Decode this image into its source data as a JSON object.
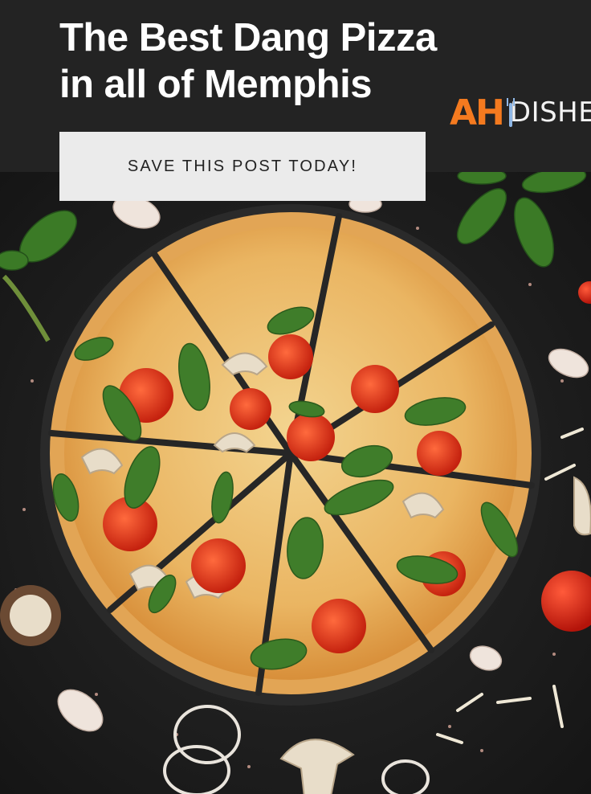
{
  "header": {
    "title_line1": "The Best Dang Pizza",
    "title_line2": "in all of Memphis",
    "save_label": "SAVE THIS POST TODAY!"
  },
  "logo": {
    "part1": "AH",
    "part2": "DISHES",
    "icon": "fork-icon",
    "colors": {
      "ah": "#f47a1f",
      "fork": "#8fb7e6",
      "dishes": "#f2f2f2"
    }
  },
  "photo": {
    "subject": "pizza-photo",
    "colors": {
      "background": "#1f1f1f",
      "crust": "#e9b36a",
      "cheese": "#f1d08a",
      "tomato": "#e23a1e",
      "basil": "#3f7d2a"
    }
  }
}
